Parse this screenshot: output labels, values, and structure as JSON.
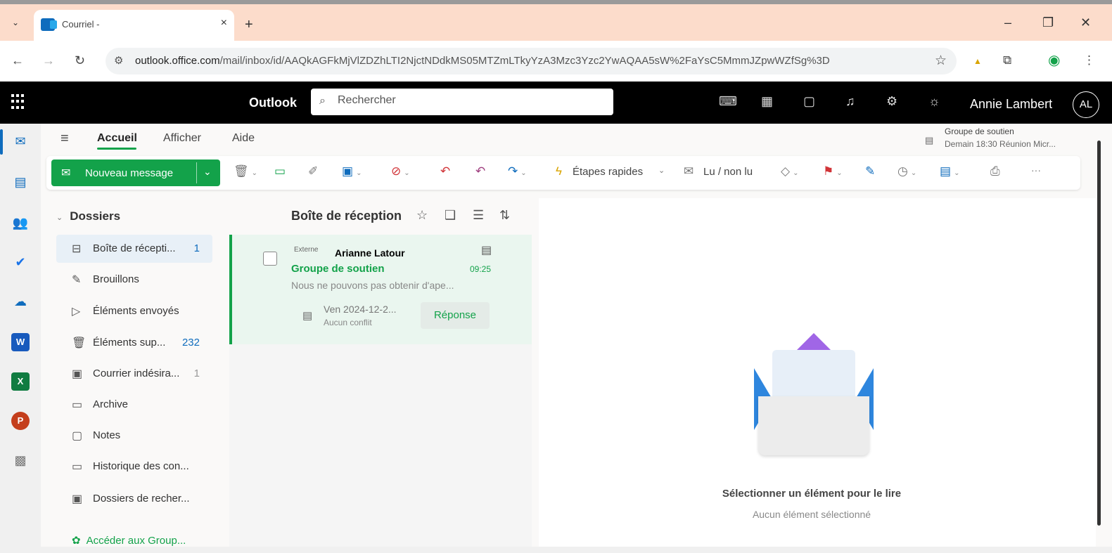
{
  "browser": {
    "tab_title": "Courriel -",
    "tab_close": "×",
    "new_tab": "+",
    "url_host": "outlook.office.com",
    "url_path": "/mail/inbox/id/AAQkAGFkMjVlZDZhLTI2NjctNDdkMS05MTZmLTkyYzA3Mzc3Yzc2YwAQAA5sW%2FaYsC5MmmJZpwWZfSg%3D"
  },
  "header": {
    "app_name": "Outlook",
    "search_placeholder": "Rechercher",
    "user_name": "Annie Lambert",
    "user_initials": "AL"
  },
  "ribbon": {
    "tabs": [
      "Accueil",
      "Afficher",
      "Aide"
    ],
    "new_message": "Nouveau message",
    "quick_steps": "Étapes rapides",
    "read_unread": "Lu / non lu",
    "more": "···"
  },
  "reminder": {
    "title": "Groupe de soutien",
    "detail": "Demain 18:30 Réunion Micr..."
  },
  "folders": {
    "header": "Dossiers",
    "items": [
      {
        "name": "Boîte de récepti...",
        "count": "1"
      },
      {
        "name": "Brouillons",
        "count": ""
      },
      {
        "name": "Éléments envoyés",
        "count": ""
      },
      {
        "name": "Éléments sup...",
        "count": "232"
      },
      {
        "name": "Courrier indésira...",
        "count": "1"
      },
      {
        "name": "Archive",
        "count": ""
      },
      {
        "name": "Notes",
        "count": ""
      },
      {
        "name": "Historique des con...",
        "count": ""
      },
      {
        "name": "Dossiers de recher...",
        "count": ""
      }
    ],
    "groups_link": "Accéder aux Group..."
  },
  "message_list": {
    "title": "Boîte de réception",
    "messages": [
      {
        "tag": "Externe",
        "sender": "Arianne Latour",
        "subject": "Groupe de soutien",
        "time": "09:25",
        "preview": "Nous ne pouvons pas obtenir d'ape...",
        "event_date": "Ven 2024-12-2...",
        "event_conflict": "Aucun conflit",
        "reply_label": "Réponse"
      }
    ]
  },
  "reading_pane": {
    "empty_title": "Sélectionner un élément pour le lire",
    "empty_subtitle": "Aucun élément sélectionné"
  },
  "colors": {
    "accent": "#0f6cbd",
    "brand_green": "#13a24a",
    "header_bg": "#000000",
    "tabbar_bg": "#fcdccb"
  }
}
